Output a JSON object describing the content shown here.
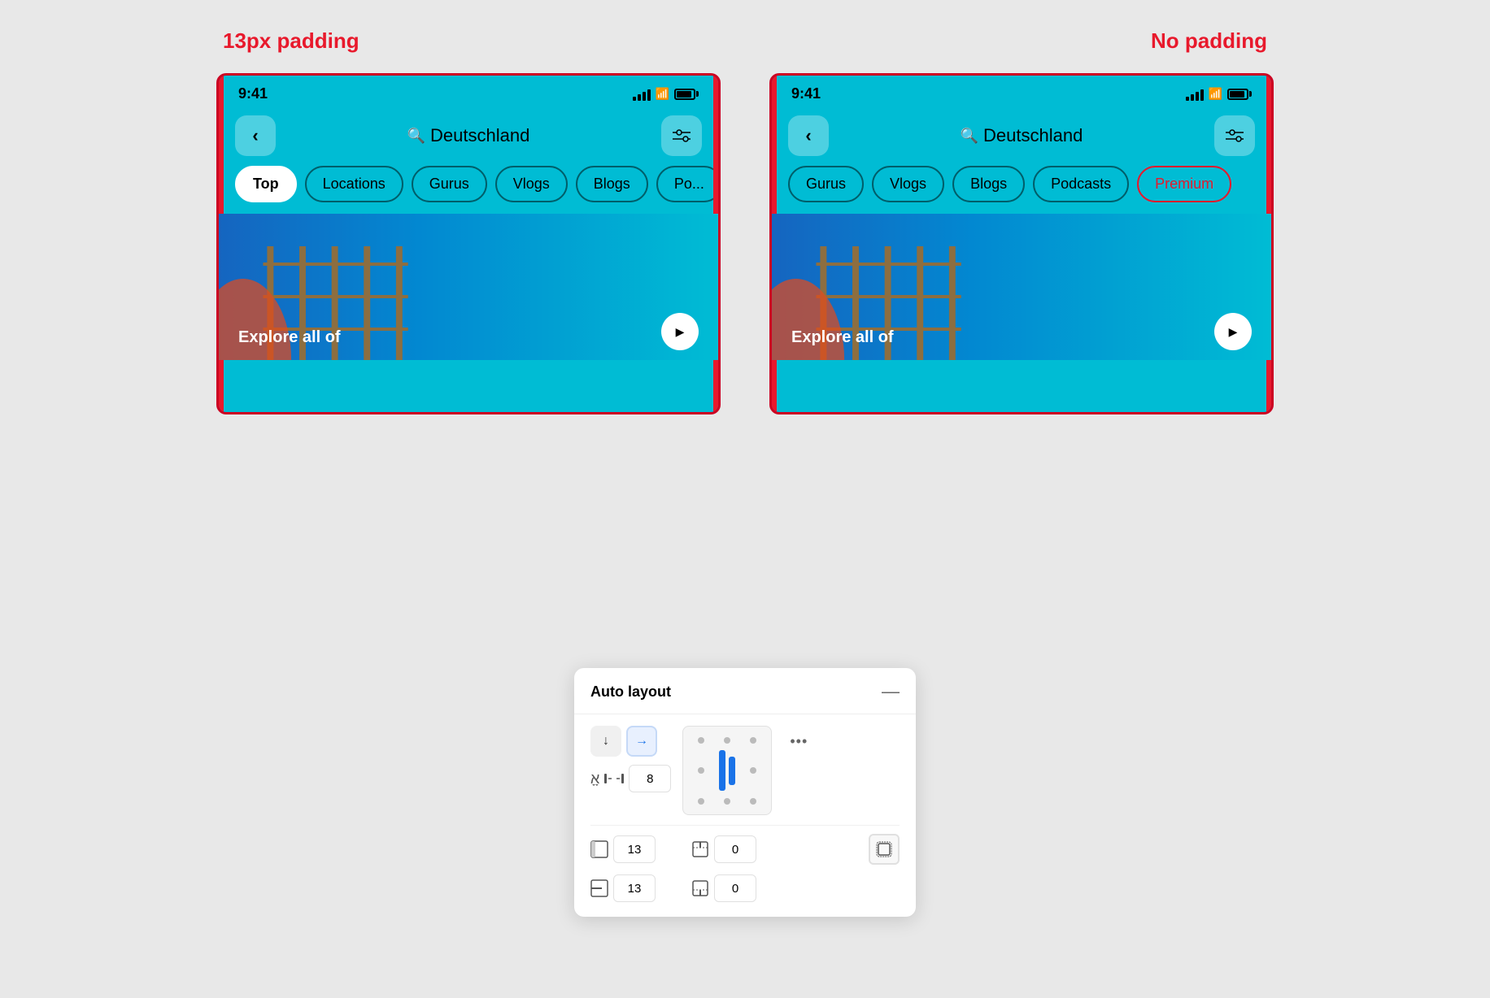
{
  "labels": {
    "left_padding": "13px padding",
    "right_padding": "No padding"
  },
  "phone": {
    "time": "9:41",
    "search_text": "Deutschland",
    "tabs": [
      "Top",
      "Locations",
      "Gurus",
      "Vlogs",
      "Blogs",
      "Po..."
    ],
    "tabs_right": [
      "Gurus",
      "Vlogs",
      "Blogs",
      "Podcasts",
      "Premium"
    ],
    "explore_text": "Explore all of",
    "active_tab": "Top"
  },
  "auto_layout": {
    "title": "Auto layout",
    "collapse_icon": "—",
    "direction_down": "↓",
    "direction_right": "→",
    "gap_value": "8",
    "padding_left": "13",
    "padding_right": "0",
    "padding_top": "13",
    "padding_bottom": "0",
    "more_icon": "•••"
  }
}
